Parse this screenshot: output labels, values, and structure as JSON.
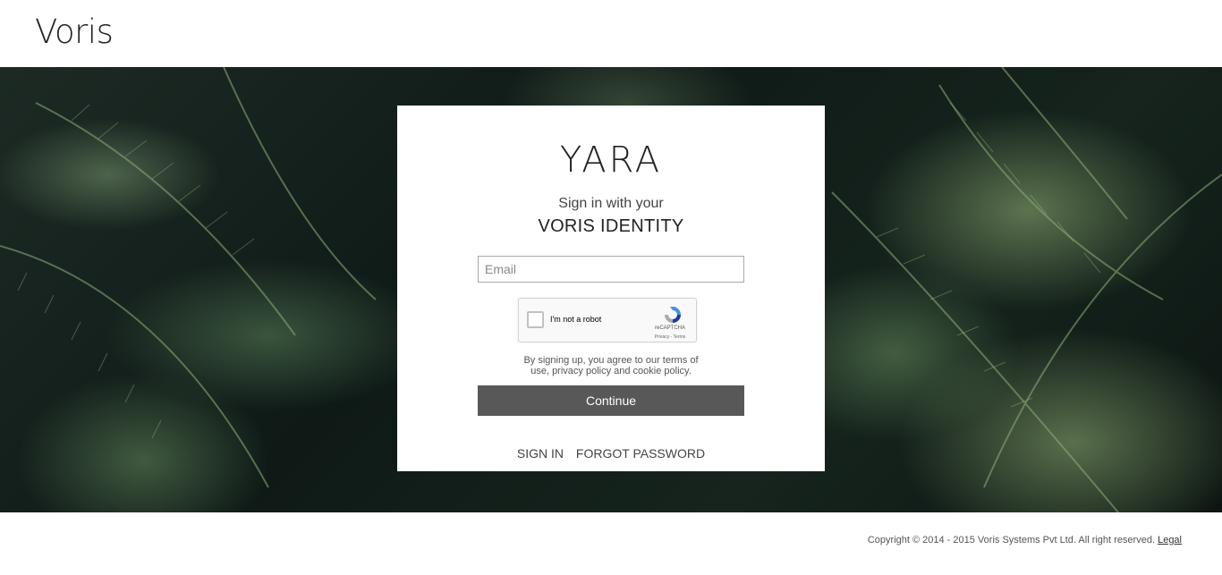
{
  "header": {
    "brand": "Voris"
  },
  "login_card": {
    "app_title": "YARA",
    "subtitle_line1": "Sign in with your",
    "subtitle_line2": "VORIS IDENTITY",
    "email": {
      "value": "",
      "placeholder": "Email"
    },
    "captcha": {
      "label": "I'm not a robot",
      "brand": "reCAPTCHA",
      "links": "Privacy - Terms",
      "checked": false
    },
    "terms_text": "By signing up, you agree to our terms of use, privacy policy and cookie policy.",
    "continue_label": "Continue",
    "links": {
      "sign_in": "SIGN IN",
      "forgot_password": "FORGOT PASSWORD"
    }
  },
  "footer": {
    "copyright": "Copyright © 2014 - 2015 Voris Systems Pvt Ltd. All right reserved.",
    "legal_link": "Legal"
  },
  "colors": {
    "continue_button": "#585858",
    "hero_background": "#16241d",
    "fern_green": "#8fae7c"
  },
  "icons": {
    "captcha_logo": "recaptcha-icon"
  }
}
